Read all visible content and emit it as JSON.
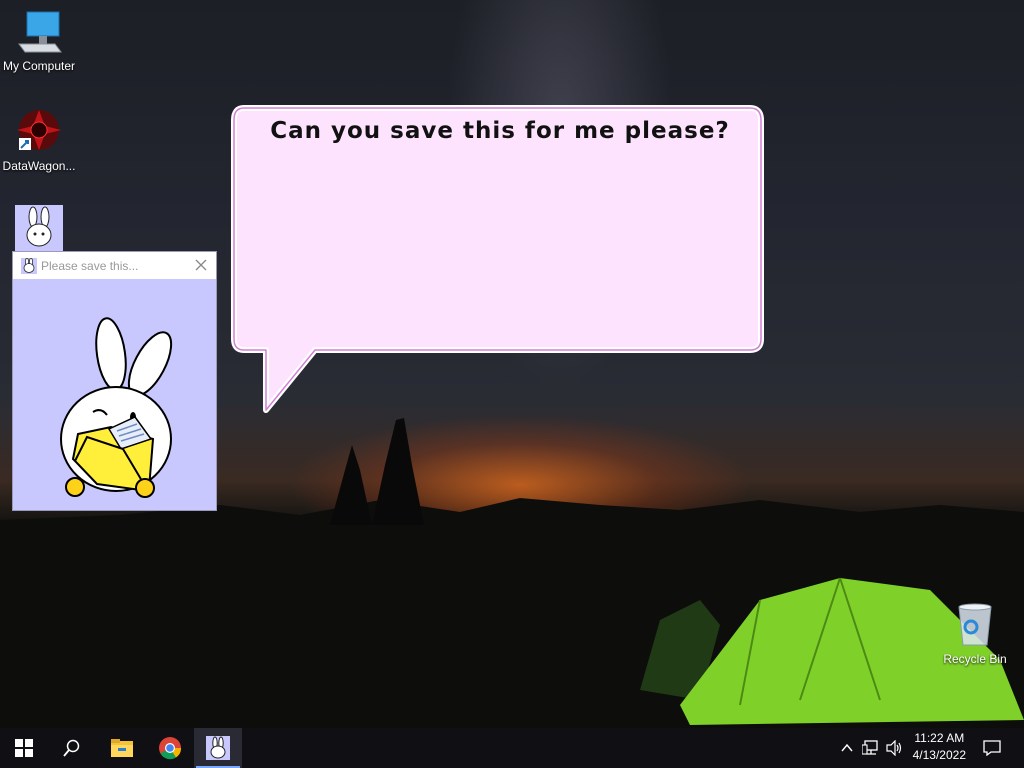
{
  "desktop": {
    "icons": [
      {
        "label": "My Computer",
        "icon": "computer-icon"
      },
      {
        "label": "DataWagon...",
        "icon": "datawagon-icon"
      },
      {
        "label": "",
        "icon": "bunny-app-icon"
      },
      {
        "label": "Recycle Bin",
        "icon": "recycle-bin-icon"
      }
    ]
  },
  "bubble": {
    "text": "Can you save this for me please?"
  },
  "app_window": {
    "title": "Please save this...",
    "illustration": "bunny-holding-folder"
  },
  "taskbar": {
    "items": [
      "start-icon",
      "search-icon",
      "file-explorer-icon",
      "chrome-icon",
      "bunny-app-icon"
    ],
    "clock": {
      "time": "11:22 AM",
      "date": "4/13/2022"
    },
    "tray": [
      "chevron-up-icon",
      "network-icon",
      "volume-icon",
      "notification-icon"
    ]
  },
  "colors": {
    "bubble_fill": "#fde3fe",
    "bubble_border": "#d37fd5",
    "window_bg": "#c8c8ff",
    "tent": "#7fd12a"
  }
}
